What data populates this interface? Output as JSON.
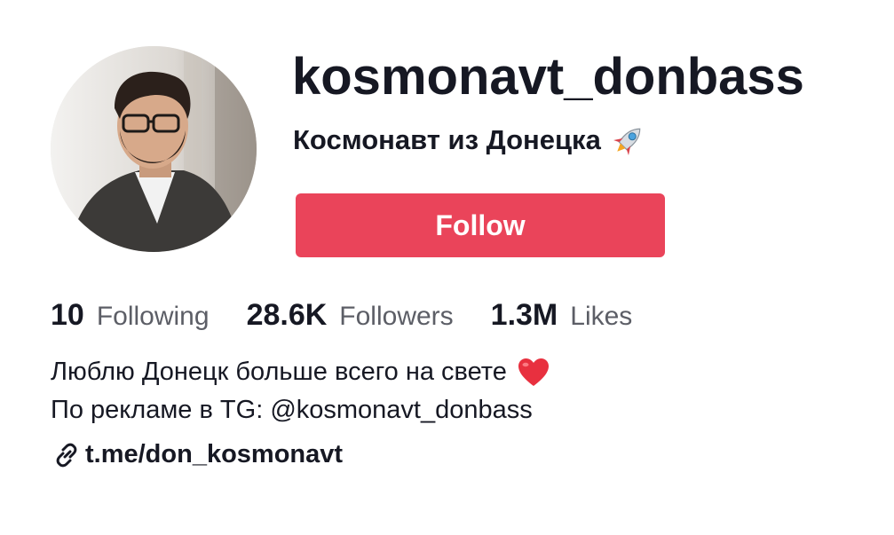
{
  "profile": {
    "username": "kosmonavt_donbass",
    "nickname": "Космонавт из Донецка",
    "nickname_icon": "rocket-icon",
    "avatar_icon": "avatar-photo"
  },
  "actions": {
    "follow_label": "Follow",
    "follow_color": "#ea445a"
  },
  "stats": [
    {
      "value": "10",
      "label": "Following"
    },
    {
      "value": "28.6K",
      "label": "Followers"
    },
    {
      "value": "1.3M",
      "label": "Likes"
    }
  ],
  "bio": {
    "line1": "Люблю Донецк больше всего на свете",
    "line1_icon": "heart-icon",
    "line2": "По рекламе в TG: @kosmonavt_donbass"
  },
  "link": {
    "icon": "link-icon",
    "text": "t.me/don_kosmonavt"
  }
}
